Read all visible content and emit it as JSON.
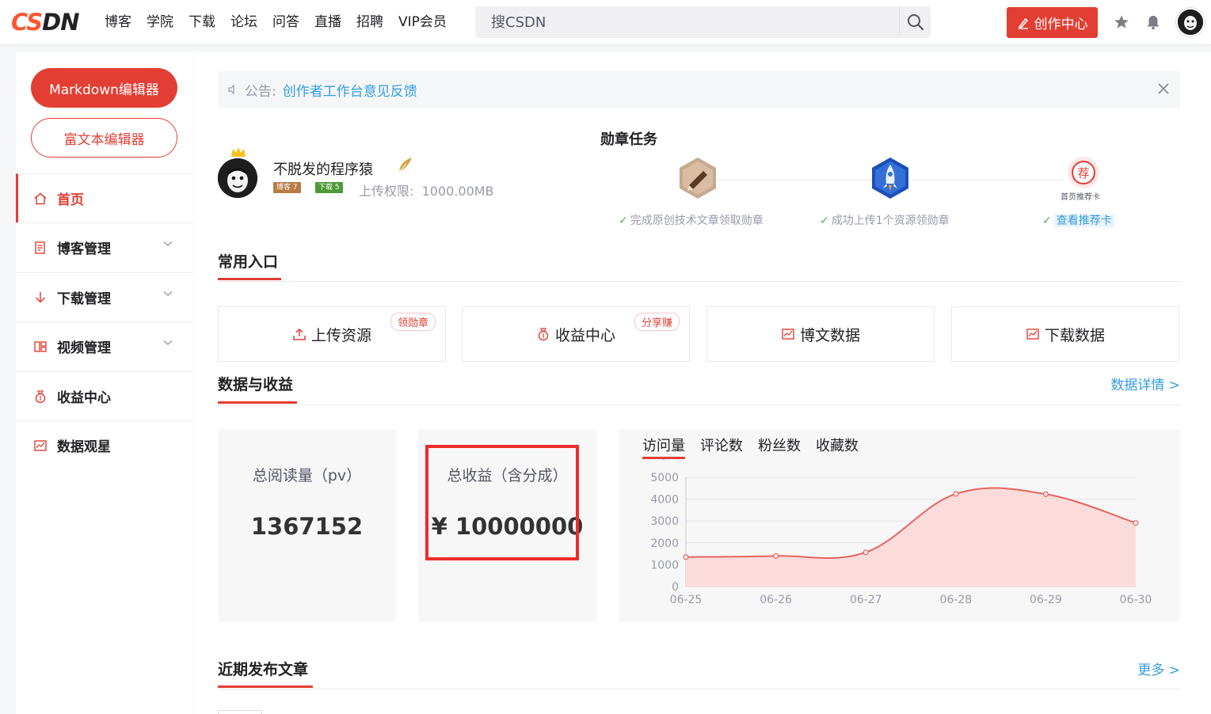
{
  "topbar": {
    "logo_accent": "CS",
    "logo_rest": "DN",
    "nav": [
      "博客",
      "学院",
      "下载",
      "论坛",
      "问答",
      "直播",
      "招聘",
      "VIP会员"
    ],
    "search_placeholder": "搜CSDN",
    "create_label": "创作中心"
  },
  "sidebar": {
    "markdown_label": "Markdown编辑器",
    "richtext_label": "富文本编辑器",
    "items": [
      {
        "label": "首页",
        "icon": "home-icon"
      },
      {
        "label": "博客管理",
        "icon": "blog-manage-icon"
      },
      {
        "label": "下载管理",
        "icon": "download-icon"
      },
      {
        "label": "视频管理",
        "icon": "video-icon"
      },
      {
        "label": "收益中心",
        "icon": "money-bag-icon"
      },
      {
        "label": "数据观星",
        "icon": "chart-icon"
      }
    ]
  },
  "notice": {
    "prefix": "公告:",
    "link": "创作者工作台意见反馈"
  },
  "profile": {
    "username": "不脱发的程序猿",
    "blog_level_label": "博客",
    "blog_level": "7",
    "download_level_label": "下载",
    "download_level": "5",
    "quota_label": "上传权限:",
    "quota_value": "1000.00MB"
  },
  "medals": {
    "title": "勋章任务",
    "items": [
      {
        "caption": "完成原创技术文章领取勋章"
      },
      {
        "caption": "成功上传1个资源领勋章"
      },
      {
        "caption": "查看推荐卡",
        "badge_label": "首页推荐卡",
        "badge_char": "荐"
      }
    ]
  },
  "common_entries": {
    "title": "常用入口",
    "items": [
      {
        "label": "上传资源",
        "tag": "领勋章"
      },
      {
        "label": "收益中心",
        "tag": "分享赚"
      },
      {
        "label": "博文数据",
        "tag": ""
      },
      {
        "label": "下载数据",
        "tag": ""
      }
    ]
  },
  "data_section": {
    "title": "数据与收益",
    "more": "数据详情 >",
    "pv_label": "总阅读量（pv）",
    "pv_value": "1367152",
    "income_label": "总收益（含分成）",
    "income_value": "¥ 10000000"
  },
  "chart_tabs": [
    "访问量",
    "评论数",
    "粉丝数",
    "收藏数"
  ],
  "chart_data": {
    "type": "area",
    "categories": [
      "06-25",
      "06-26",
      "06-27",
      "06-28",
      "06-29",
      "06-30"
    ],
    "values": [
      1350,
      1400,
      1570,
      4240,
      4230,
      2910
    ],
    "ylim": [
      0,
      5000
    ],
    "yticks": [
      0,
      1000,
      2000,
      3000,
      4000,
      5000
    ],
    "color": "#e6645f",
    "fill": "#fbdcdb",
    "title": "",
    "xlabel": "",
    "ylabel": ""
  },
  "recent": {
    "title": "近期发布文章",
    "more": "更多 >"
  },
  "colors": {
    "brand_red": "#e33e33",
    "link_blue": "#349edf"
  }
}
